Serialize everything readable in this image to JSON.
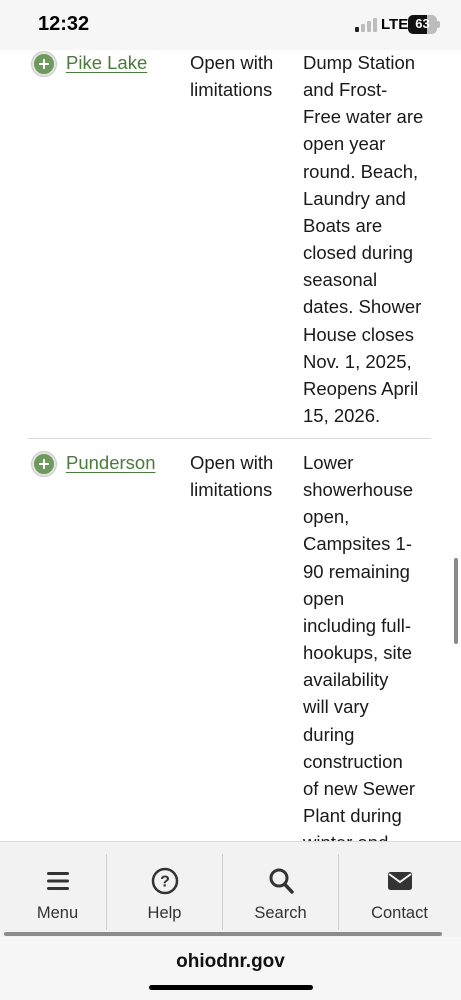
{
  "status_bar": {
    "time": "12:32",
    "network": "LTE",
    "battery": "63"
  },
  "table": {
    "rows": [
      {
        "park": "Pike Lake",
        "status": [
          "Open with",
          "limitations"
        ],
        "notes": [
          "Dump Station",
          "and Frost-",
          "Free water are",
          "open year",
          "round. Beach,",
          "Laundry and",
          "Boats are",
          "closed during",
          "seasonal",
          "dates. Shower",
          "House closes",
          "Nov. 1, 2025,",
          "Reopens April",
          "15, 2026."
        ]
      },
      {
        "park": "Punderson",
        "status": [
          "Open with",
          "limitations"
        ],
        "notes": [
          "Lower",
          "showerhouse",
          "open,",
          "Campsites 1-",
          "90 remaining",
          "open",
          "including full-",
          "hookups, site",
          "availability",
          "will vary",
          "during",
          "construction",
          "of new Sewer",
          "Plant during",
          "winter and"
        ]
      }
    ]
  },
  "bottom_nav": {
    "items": [
      {
        "label": "Menu",
        "icon": "menu-icon"
      },
      {
        "label": "Help",
        "icon": "help-icon"
      },
      {
        "label": "Search",
        "icon": "search-icon"
      },
      {
        "label": "Contact",
        "icon": "mail-icon"
      }
    ]
  },
  "browser": {
    "url": "ohiodnr.gov"
  },
  "colors": {
    "link": "#4a7a3c",
    "expand_button": "#6e9a5e",
    "nav_background": "#f2f2f2"
  }
}
